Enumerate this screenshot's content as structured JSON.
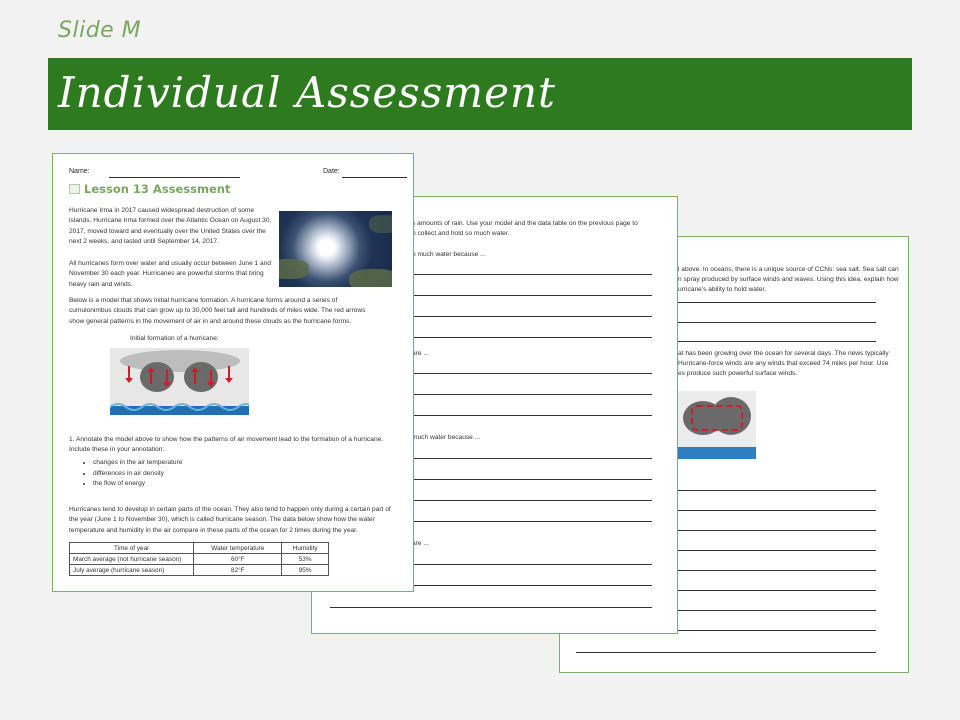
{
  "slide_label": "Slide M",
  "title": "Individual Assessment",
  "page1": {
    "name_label": "Name:",
    "date_label": "Date:",
    "lesson_title": "Lesson 13 Assessment",
    "intro": "Hurricane Irma in 2017 caused widespread destruction of some islands. Hurricane Irma formed over the Atlantic Ocean on August 30, 2017, moved toward and eventually over the United States over the next 2 weeks, and lasted until September 14, 2017.",
    "para2": "All hurricanes form over water and usually occur between June 1 and November 30 each year. Hurricanes are powerful storms that bring heavy rain and winds.",
    "para3": "Below is a model that shows initial hurricane formation. A hurricane forms around a series of cumulonimbus clouds that can grow up to 30,000 feet tall and hundreds of miles wide. The red arrows show general patterns in the movement of air in and around these clouds as the hurricane forms.",
    "diagram_caption": "Initial formation of a hurricane:",
    "question1": "1. Annotate the model above to show how the patterns of air movement lead to the formation of a hurricane. Include these in your annotation:",
    "bullets": [
      "changes in the air temperature",
      "differences in air density",
      "the flow of energy"
    ],
    "para4": "Hurricanes tend to develop in certain parts of the ocean. They also tend to happen only during a certain part of the year (June 1 to November 30), which is called hurricane season. The data below show how the water temperature and humidity in the air compare in these parts of the ocean for 2 times during the year.",
    "table": {
      "headers": [
        "Time of year",
        "Water temperature",
        "Humidity"
      ],
      "rows": [
        [
          "March average (not hurricane season)",
          "60°F",
          "53%"
        ],
        [
          "July average (hurricane season)",
          "82°F",
          "95%"
        ]
      ]
    }
  },
  "page2": {
    "line1": "s amounts of rain. Use your model and the data table on the previous page to",
    "line2": "n collect and hold so much water.",
    "p1": "o much water because ...",
    "p2": "are ...",
    "p3": "much water because ...",
    "p4": "are ..."
  },
  "page3": {
    "l1": "l above. In oceans, there is a unique source of CCNs: sea salt. Sea salt can",
    "l2": "n spray produced by surface winds and waves. Using this idea, explain how",
    "l3": "urricane's ability to hold water.",
    "l4": "at has been growing over the ocean for several days. The news typically",
    "l5": "Hurricane-force winds are any winds that exceed 74 miles per hour. Use",
    "l6": "es produce such powerful surface winds."
  },
  "colors": {
    "title_bar": "#2e7a1e",
    "accent": "#7aa75f",
    "arrow": "#c8202a"
  }
}
